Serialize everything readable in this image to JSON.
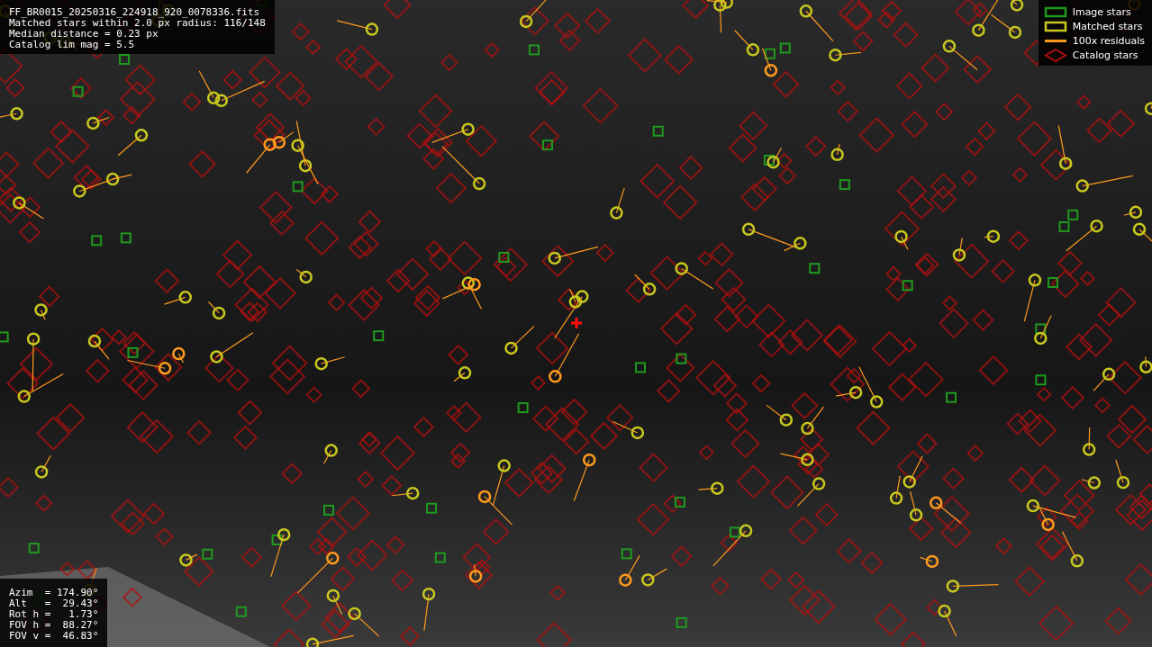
{
  "info": {
    "lines": [
      "FF_BR0015_20250316_224918_920_0078336.fits",
      "Matched stars within 2.0 px radius: 116/148",
      "Median distance = 0.23 px",
      "Catalog lim mag = 5.5"
    ]
  },
  "legend": [
    {
      "kind": "box",
      "label": "Image stars",
      "color": "#1f9a1f"
    },
    {
      "kind": "box",
      "label": "Matched stars",
      "color": "#c8c81e"
    },
    {
      "kind": "line",
      "label": "100x residuals",
      "color": "#ff9a1e"
    },
    {
      "kind": "diamond",
      "label": "Catalog stars",
      "color": "#b01010"
    }
  ],
  "pointing": {
    "lines": [
      "Azim  = 174.90°",
      "Alt   =  29.43°",
      "Rot h =   1.73°",
      "FOV h =  88.27°",
      "FOV v =  46.83°"
    ]
  }
}
